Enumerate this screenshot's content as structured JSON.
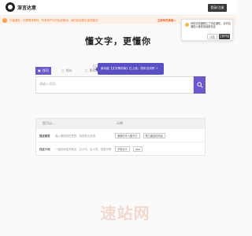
{
  "header": {
    "brand": "深言达意",
    "login_label": "登录/注册"
  },
  "notice": {
    "icon": "!",
    "text": "升级通告：无需再排等待、所有用户均可免费使用，我们欢迎提出宝贵建议！",
    "link": "立即抢先体验 ▸"
  },
  "notification_popup": {
    "text": "你的浏览器禁止了消息通知，请开启通知以便收到最新信息",
    "close_label": "以后",
    "allow_label": "立即开启"
  },
  "slogan": "懂文字，更懂你",
  "tabs": [
    {
      "label": "找词",
      "icon": "▣"
    },
    {
      "label": "找句",
      "icon": "▢"
    },
    {
      "label": "素材库",
      "icon": "▢"
    }
  ],
  "new_badge": "New",
  "promo_tip": "新功能【文字素材库】已上线，快来试试吧 →",
  "search": {
    "placeholder": "请输入词语..."
  },
  "table": {
    "col1": "您可以...",
    "col2": "示例",
    "rows": [
      {
        "title": "描述意思",
        "desc": "输入想描述的意思，找到表达用语",
        "chips": [
          "美丽的令人爱不已",
          "努力面容的作品"
        ]
      },
      {
        "title": "找近义词",
        "desc": "一键查询相关概念，近义词，反义词，类型词等",
        "chips": [
          "不有论义",
          "dad"
        ]
      }
    ]
  },
  "watermark": "速站网",
  "colors": {
    "accent": "#6a5acd",
    "notice_bg": "#fdf1e7",
    "notice_text": "#e87b3a"
  }
}
